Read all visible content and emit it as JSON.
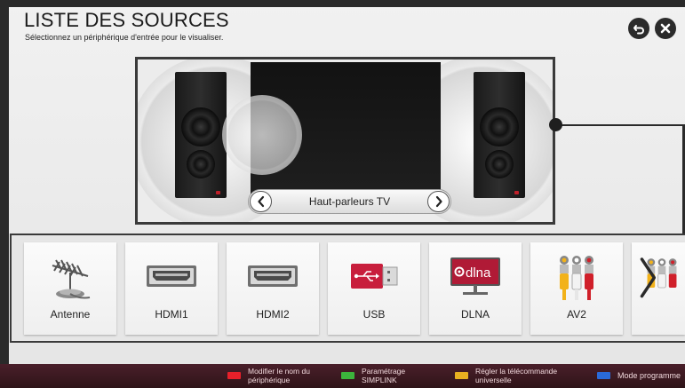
{
  "header": {
    "title": "LISTE DES SOURCES",
    "subtitle": "Sélectionnez un périphérique d'entrée pour le visualiser."
  },
  "preview": {
    "selected_output": "Haut-parleurs TV"
  },
  "sources": [
    {
      "label": "Antenne",
      "icon": "antenna-icon"
    },
    {
      "label": "HDMI1",
      "icon": "hdmi-port-icon"
    },
    {
      "label": "HDMI2",
      "icon": "hdmi-port-icon"
    },
    {
      "label": "USB",
      "icon": "usb-icon"
    },
    {
      "label": "DLNA",
      "icon": "dlna-icon",
      "icon_text": "dlna"
    },
    {
      "label": "AV2",
      "icon": "rca-cables-icon"
    },
    {
      "label": "",
      "icon": "rca-cables-icon"
    }
  ],
  "bottom_bar": [
    {
      "key_color": "#e8202a",
      "text_line1": "Modifier le nom du",
      "text_line2": "périphérique"
    },
    {
      "key_color": "#3cb43c",
      "text_line1": "Paramétrage",
      "text_line2": "SIMPLINK"
    },
    {
      "key_color": "#e8b020",
      "text_line1": "Régler la télécommande",
      "text_line2": "universelle"
    },
    {
      "key_color": "#2a6ad8",
      "text_line1": "Mode programme",
      "text_line2": ""
    }
  ],
  "colors": {
    "frame_border": "#3a3a3a",
    "bottom_bar": "#3a1820",
    "speaker_led": "#c0202a"
  }
}
